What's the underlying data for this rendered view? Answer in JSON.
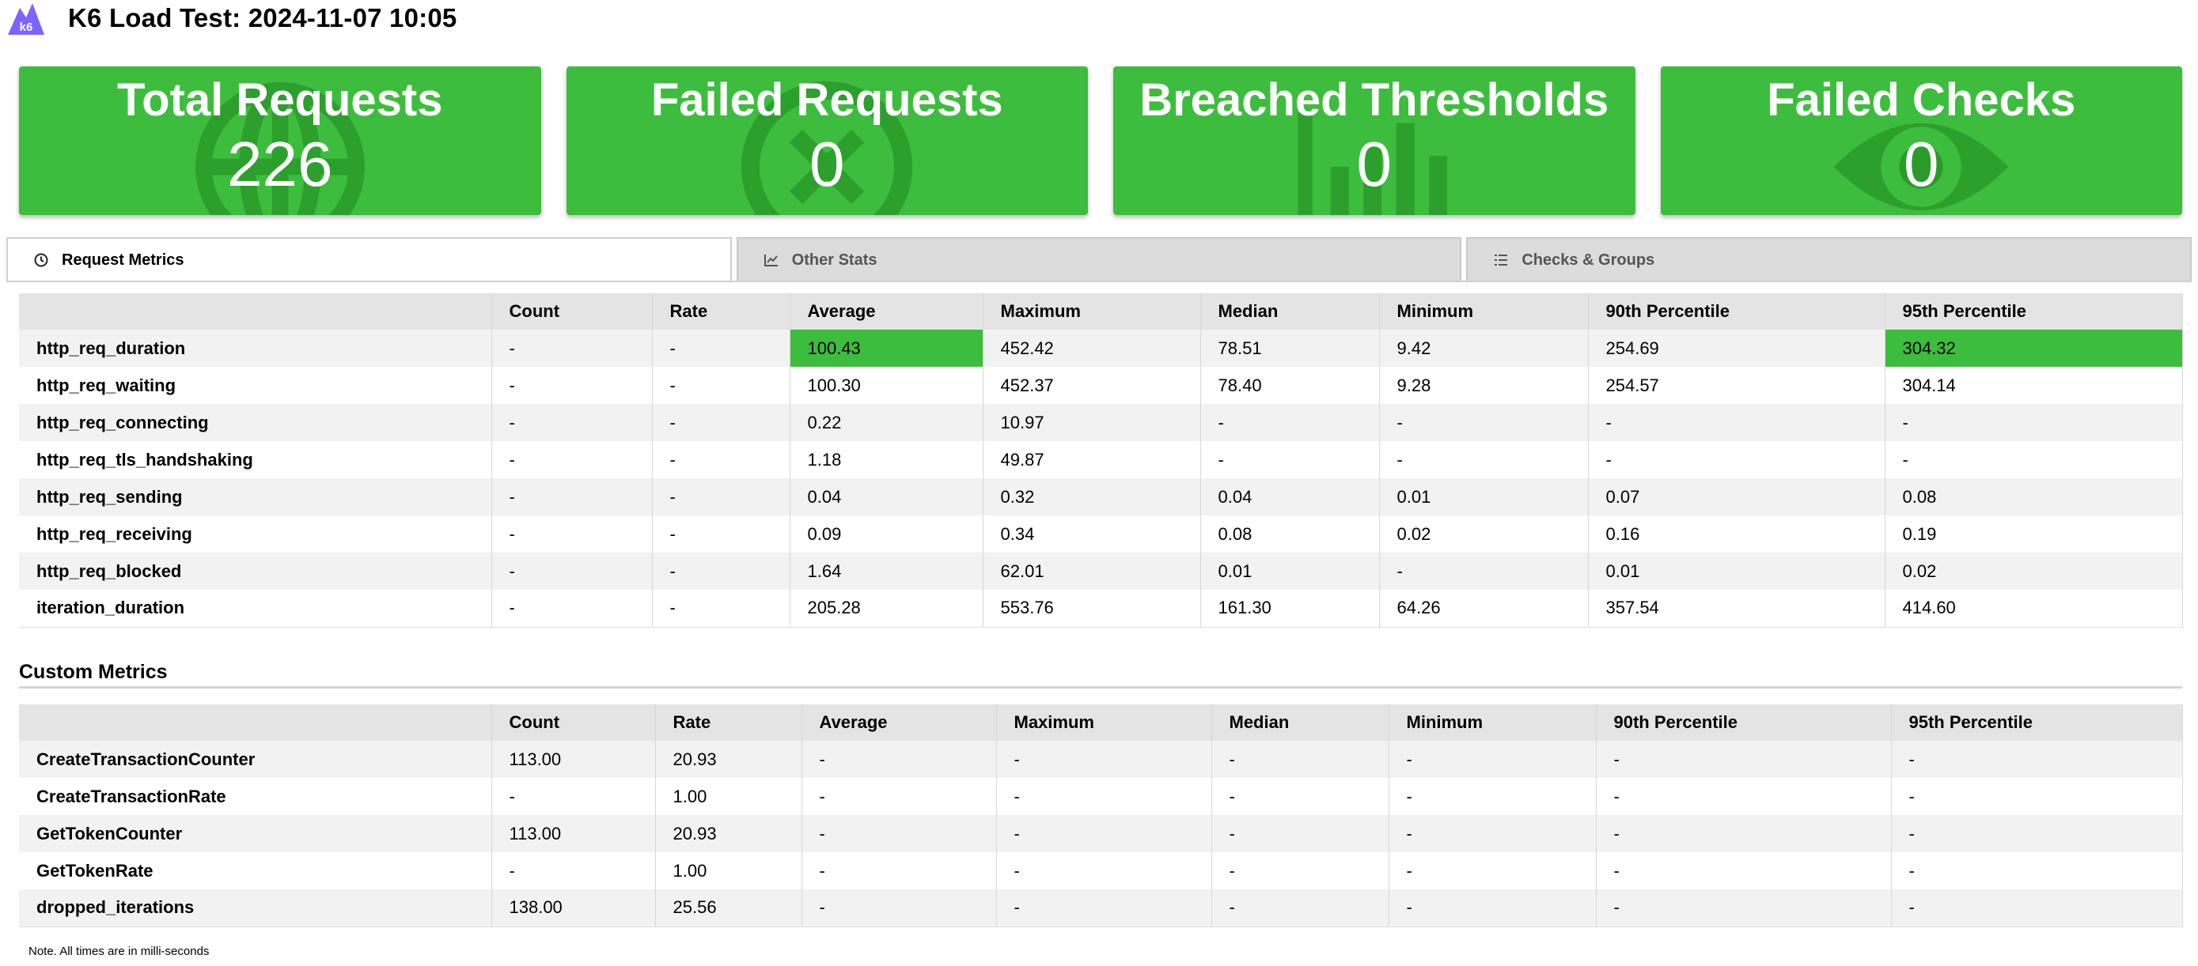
{
  "header": {
    "logo_text": "k6",
    "title": "K6 Load Test: 2024-11-07 10:05"
  },
  "cards": [
    {
      "label": "Total Requests",
      "value": "226",
      "icon": "globe-icon"
    },
    {
      "label": "Failed Requests",
      "value": "0",
      "icon": "x-circle-icon"
    },
    {
      "label": "Breached Thresholds",
      "value": "0",
      "icon": "bar-chart-icon"
    },
    {
      "label": "Failed Checks",
      "value": "0",
      "icon": "eye-icon"
    }
  ],
  "tabs": [
    {
      "label": "Request Metrics",
      "icon": "clock-icon",
      "active": true
    },
    {
      "label": "Other Stats",
      "icon": "line-chart-icon",
      "active": false
    },
    {
      "label": "Checks & Groups",
      "icon": "list-icon",
      "active": false
    }
  ],
  "request_metrics": {
    "columns": [
      "",
      "Count",
      "Rate",
      "Average",
      "Maximum",
      "Median",
      "Minimum",
      "90th Percentile",
      "95th Percentile"
    ],
    "rows": [
      [
        "http_req_duration",
        "-",
        "-",
        "100.43",
        "452.42",
        "78.51",
        "9.42",
        "254.69",
        "304.32"
      ],
      [
        "http_req_waiting",
        "-",
        "-",
        "100.30",
        "452.37",
        "78.40",
        "9.28",
        "254.57",
        "304.14"
      ],
      [
        "http_req_connecting",
        "-",
        "-",
        "0.22",
        "10.97",
        "-",
        "-",
        "-",
        "-"
      ],
      [
        "http_req_tls_handshaking",
        "-",
        "-",
        "1.18",
        "49.87",
        "-",
        "-",
        "-",
        "-"
      ],
      [
        "http_req_sending",
        "-",
        "-",
        "0.04",
        "0.32",
        "0.04",
        "0.01",
        "0.07",
        "0.08"
      ],
      [
        "http_req_receiving",
        "-",
        "-",
        "0.09",
        "0.34",
        "0.08",
        "0.02",
        "0.16",
        "0.19"
      ],
      [
        "http_req_blocked",
        "-",
        "-",
        "1.64",
        "62.01",
        "0.01",
        "-",
        "0.01",
        "0.02"
      ],
      [
        "iteration_duration",
        "-",
        "-",
        "205.28",
        "553.76",
        "161.30",
        "64.26",
        "357.54",
        "414.60"
      ]
    ],
    "highlighted_cells": [
      [
        0,
        3
      ],
      [
        0,
        8
      ]
    ]
  },
  "custom_metrics": {
    "title": "Custom Metrics",
    "columns": [
      "",
      "Count",
      "Rate",
      "Average",
      "Maximum",
      "Median",
      "Minimum",
      "90th Percentile",
      "95th Percentile"
    ],
    "rows": [
      [
        "CreateTransactionCounter",
        "113.00",
        "20.93",
        "-",
        "-",
        "-",
        "-",
        "-",
        "-"
      ],
      [
        "CreateTransactionRate",
        "-",
        "1.00",
        "-",
        "-",
        "-",
        "-",
        "-",
        "-"
      ],
      [
        "GetTokenCounter",
        "113.00",
        "20.93",
        "-",
        "-",
        "-",
        "-",
        "-",
        "-"
      ],
      [
        "GetTokenRate",
        "-",
        "1.00",
        "-",
        "-",
        "-",
        "-",
        "-",
        "-"
      ],
      [
        "dropped_iterations",
        "138.00",
        "25.56",
        "-",
        "-",
        "-",
        "-",
        "-",
        "-"
      ]
    ]
  },
  "footnote": "Note. All times are in milli-seconds",
  "colors": {
    "success_green": "#3dbd3d",
    "logo_purple": "#7d64ff",
    "header_gray": "#e4e4e4"
  }
}
